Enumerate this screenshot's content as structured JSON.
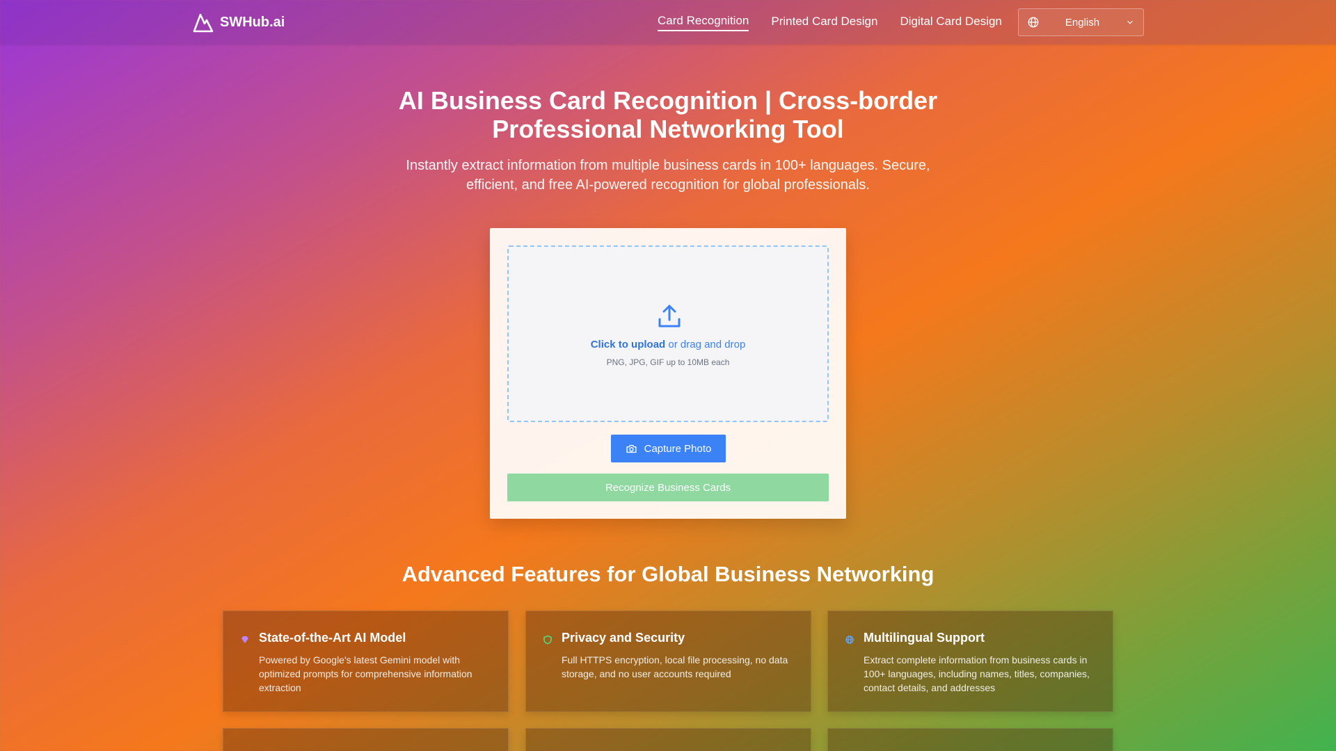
{
  "nav": {
    "brand": "SWHub.ai",
    "links": [
      {
        "label": "Card Recognition",
        "active": true
      },
      {
        "label": "Printed Card Design",
        "active": false
      },
      {
        "label": "Digital Card Design",
        "active": false
      }
    ],
    "language": "English",
    "icons": {
      "logo": "mountain-logo-icon",
      "globe": "globe-icon",
      "chevron": "chevron-down-icon"
    }
  },
  "hero": {
    "title": "AI Business Card Recognition | Cross-border Professional Networking Tool",
    "subtitle": "Instantly extract information from multiple business cards in 100+ languages. Secure, efficient, and free AI-powered recognition for global professionals."
  },
  "upload": {
    "click_label": "Click to upload",
    "drag_label": " or drag and drop",
    "hint": "PNG, JPG, GIF up to 10MB each",
    "capture_label": "Capture Photo",
    "recognize_label": "Recognize Business Cards",
    "icons": {
      "upload": "upload-arrow-icon",
      "camera": "camera-icon"
    }
  },
  "features": {
    "title": "Advanced Features for Global Business Networking",
    "items": [
      {
        "title": "State-of-the-Art AI Model",
        "description": "Powered by Google's latest Gemini model with optimized prompts for comprehensive information extraction",
        "icon": "gem-icon",
        "color": "#c084fc"
      },
      {
        "title": "Privacy and Security",
        "description": "Full HTTPS encryption, local file processing, no data storage, and no user accounts required",
        "icon": "shield-icon",
        "color": "#4ade80"
      },
      {
        "title": "Multilingual Support",
        "description": "Extract complete information from business cards in 100+ languages, including names, titles, companies, contact details, and addresses",
        "icon": "globe-icon",
        "color": "#60a5fa"
      }
    ]
  },
  "colors": {
    "primary": "#3b82f6",
    "recognize_disabled": "#8fd9a1",
    "dropzone_border": "#93c5fd"
  }
}
